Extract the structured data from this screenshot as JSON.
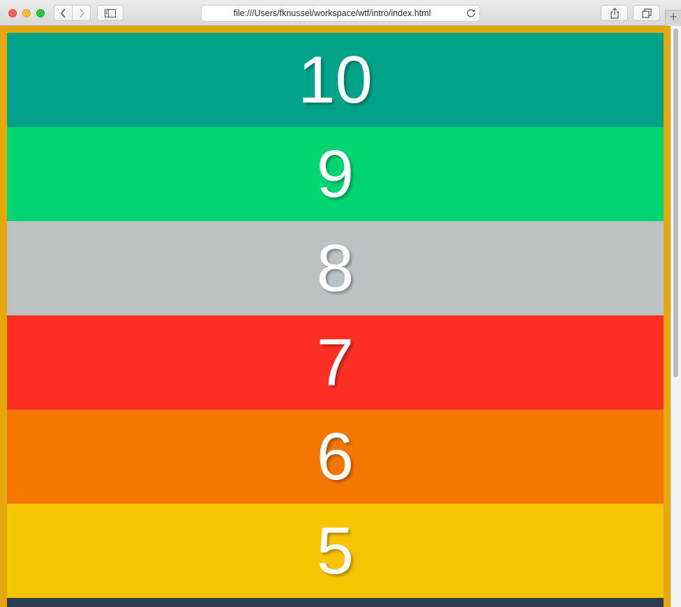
{
  "browser": {
    "url": "file:///Users/fknussel/workspace/wtf/intro/index.html"
  },
  "icons": {
    "back": "chevron-left-icon",
    "forward": "chevron-right-icon",
    "sidebar": "sidebar-icon",
    "reload": "reload-icon",
    "share": "share-icon",
    "tabs": "tabs-overview-icon",
    "new_tab": "plus-icon"
  },
  "page": {
    "background": "#e6a70d",
    "slides": [
      {
        "label": "10",
        "color": "#00a388"
      },
      {
        "label": "9",
        "color": "#00d572"
      },
      {
        "label": "8",
        "color": "#bcc1c4"
      },
      {
        "label": "7",
        "color": "#fe2f23"
      },
      {
        "label": "6",
        "color": "#f57600"
      },
      {
        "label": "5",
        "color": "#f6c500"
      },
      {
        "label": "",
        "color": "#2c3e4f"
      }
    ]
  }
}
